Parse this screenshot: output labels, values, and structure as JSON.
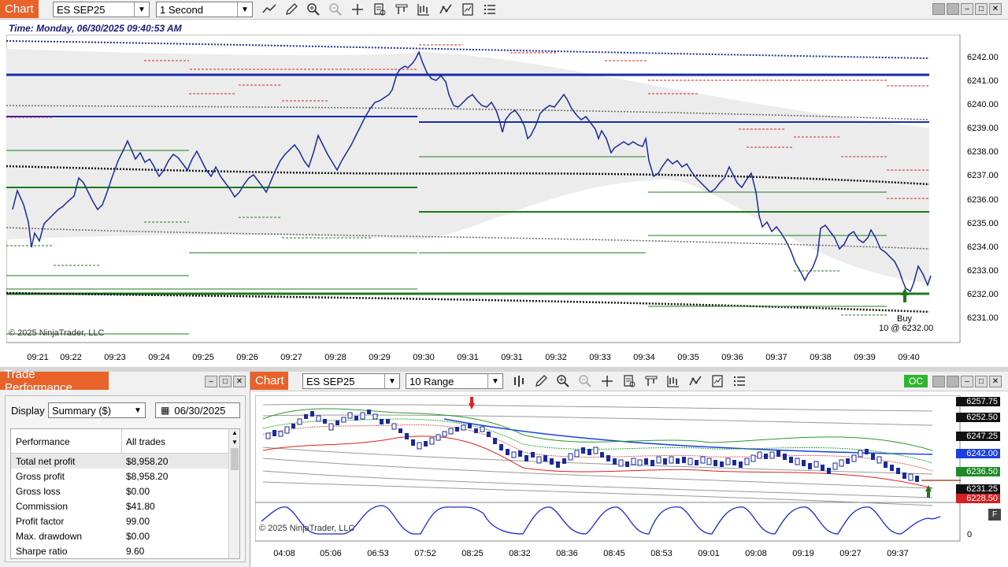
{
  "top_chart": {
    "tab_label": "Chart",
    "instrument": "ES SEP25",
    "interval": "1 Second",
    "time_label": "Time: Monday, 06/30/2025 09:40:53 AM",
    "copyright": "© 2025 NinjaTrader, LLC",
    "price_axis": [
      "6242.00",
      "6241.00",
      "6240.00",
      "6239.00",
      "6238.00",
      "6237.00",
      "6236.00",
      "6235.00",
      "6234.00",
      "6233.00",
      "6232.00",
      "6231.00"
    ],
    "time_axis": [
      "09:21",
      "09:22",
      "09:23",
      "09:24",
      "09:25",
      "09:26",
      "09:27",
      "09:28",
      "09:29",
      "09:30",
      "09:31",
      "09:31",
      "09:32",
      "09:33",
      "09:34",
      "09:35",
      "09:36",
      "09:37",
      "09:38",
      "09:39",
      "09:40"
    ],
    "execution_label_1": "Buy",
    "execution_label_2": "10 @ 6232.00"
  },
  "trade_performance": {
    "title": "Trade Performance",
    "display_label": "Display",
    "display_value": "Summary ($)",
    "date_value": "06/30/2025",
    "col_performance": "Performance",
    "col_all_trades": "All trades",
    "rows": [
      {
        "label": "Total net profit",
        "value": "$8,958.20"
      },
      {
        "label": "Gross profit",
        "value": "$8,958.20"
      },
      {
        "label": "Gross loss",
        "value": "$0.00"
      },
      {
        "label": "Commission",
        "value": "$41.80"
      },
      {
        "label": "Profit factor",
        "value": "99.00"
      },
      {
        "label": "Max. drawdown",
        "value": "$0.00"
      },
      {
        "label": "Sharpe ratio",
        "value": "9.60"
      }
    ]
  },
  "bottom_chart": {
    "tab_label": "Chart",
    "instrument": "ES SEP25",
    "interval": "10 Range",
    "oc_label": "OC",
    "copyright": "© 2025 NinjaTrader, LLC",
    "f_label": "F",
    "zero_label": "0",
    "price_tags": [
      {
        "text": "6257.75",
        "color": "#111111"
      },
      {
        "text": "6252.50",
        "color": "#111111"
      },
      {
        "text": "6247.25",
        "color": "#111111"
      },
      {
        "text": "6242.00",
        "color": "#1a3fe0"
      },
      {
        "text": "6236.50",
        "color": "#1f8a2a"
      },
      {
        "text": "6231.25",
        "color": "#111111"
      },
      {
        "text": "6228.50",
        "color": "#d42020"
      }
    ],
    "time_axis": [
      "04:08",
      "05:06",
      "06:53",
      "07:52",
      "08:25",
      "08:32",
      "08:36",
      "08:45",
      "08:53",
      "09:01",
      "09:08",
      "09:19",
      "09:27",
      "09:37"
    ]
  }
}
